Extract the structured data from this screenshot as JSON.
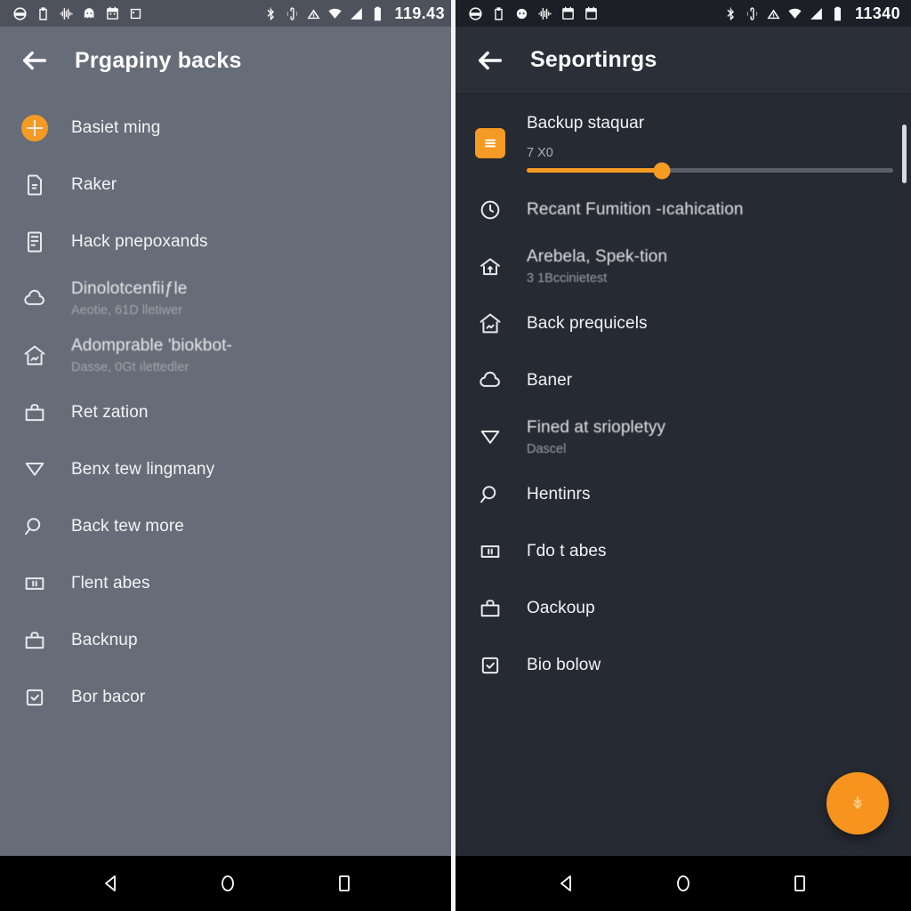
{
  "left": {
    "status_bar": {
      "clock": "119.43",
      "left_icons": [
        "steering-wheel-icon",
        "clipboard-icon",
        "waveform-icon",
        "ghost-icon",
        "calendar-icon",
        "square-dot-icon"
      ],
      "right_icons": [
        "bluetooth-icon",
        "nfc-icon",
        "alarm-icon",
        "wifi-icon",
        "signal-icon",
        "battery-icon"
      ]
    },
    "appbar": {
      "back": "back-arrow-icon",
      "title": "Prgapiny backs"
    },
    "items": [
      {
        "icon": "plus-circle-icon",
        "title": "Basiet ming",
        "sub": ""
      },
      {
        "icon": "file-icon",
        "title": "Raker",
        "sub": ""
      },
      {
        "icon": "document-icon",
        "title": "Hack pnepoxands",
        "sub": ""
      },
      {
        "icon": "cloud-icon",
        "title": "Dinolotcenfiiƒle",
        "sub": "Aeotie, 61D lletiwer"
      },
      {
        "icon": "home-image-icon",
        "title": "Adomprable 'biokbot-",
        "sub": "Dasse, 0Gt ılettedler"
      },
      {
        "icon": "briefcase-icon",
        "title": "Ret zation",
        "sub": ""
      },
      {
        "icon": "funnel-icon",
        "title": "Benx tew lingmany",
        "sub": ""
      },
      {
        "icon": "search-icon",
        "title": "Back tew more",
        "sub": ""
      },
      {
        "icon": "columns-icon",
        "title": "Γlent abes",
        "sub": ""
      },
      {
        "icon": "briefcase-icon",
        "title": "Backnup",
        "sub": ""
      },
      {
        "icon": "checkbox-icon",
        "title": "Bor bacor",
        "sub": ""
      }
    ],
    "navbar": {
      "back": "nav-back-icon",
      "home": "nav-home-icon",
      "recents": "nav-recents-icon"
    }
  },
  "right": {
    "status_bar": {
      "clock": "11340",
      "left_icons": [
        "steering-wheel-icon",
        "clipboard-icon",
        "face-icon",
        "waveform-icon",
        "calendar-icon",
        "calendar-alt-icon"
      ],
      "right_icons": [
        "bluetooth-icon",
        "nfc-icon",
        "alarm-icon",
        "wifi-icon",
        "signal-icon",
        "battery-icon"
      ]
    },
    "appbar": {
      "back": "back-arrow-icon",
      "title": "Seportinrgs"
    },
    "slider": {
      "icon": "list-square-icon",
      "label": "Backup staquar",
      "value": "7 X0",
      "fill_percent": 37
    },
    "items": [
      {
        "icon": "clock-icon",
        "title": "Recant Fumition -ıcahication",
        "sub": ""
      },
      {
        "icon": "home-arrow-icon",
        "title": "Arebela, Spek-tion",
        "sub": "3 1Bccinietest"
      },
      {
        "icon": "home-image-icon",
        "title": "Back prequicels",
        "sub": ""
      },
      {
        "icon": "cloud-icon",
        "title": "Baner",
        "sub": ""
      },
      {
        "icon": "funnel-icon",
        "title": "Fined at sriopletyy",
        "sub": "Dascel"
      },
      {
        "icon": "search-icon",
        "title": "Hentinrs",
        "sub": ""
      },
      {
        "icon": "columns-icon",
        "title": "Γdo t abes",
        "sub": ""
      },
      {
        "icon": "briefcase-icon",
        "title": "Oackoup",
        "sub": ""
      },
      {
        "icon": "checkbox-icon",
        "title": "Bio bolow",
        "sub": ""
      }
    ],
    "fab": {
      "icon": "leaf-icon"
    },
    "scrollbar": {
      "visible": true
    },
    "navbar": {
      "back": "nav-back-icon",
      "home": "nav-home-icon",
      "recents": "nav-recents-icon"
    }
  },
  "colors": {
    "accent": "#f59a23",
    "fab": "#f7941d",
    "left_bg": "#676d78",
    "right_bg": "#262a33",
    "status_left_bg": "#4e525c",
    "status_right_bg": "#1c1f26"
  }
}
